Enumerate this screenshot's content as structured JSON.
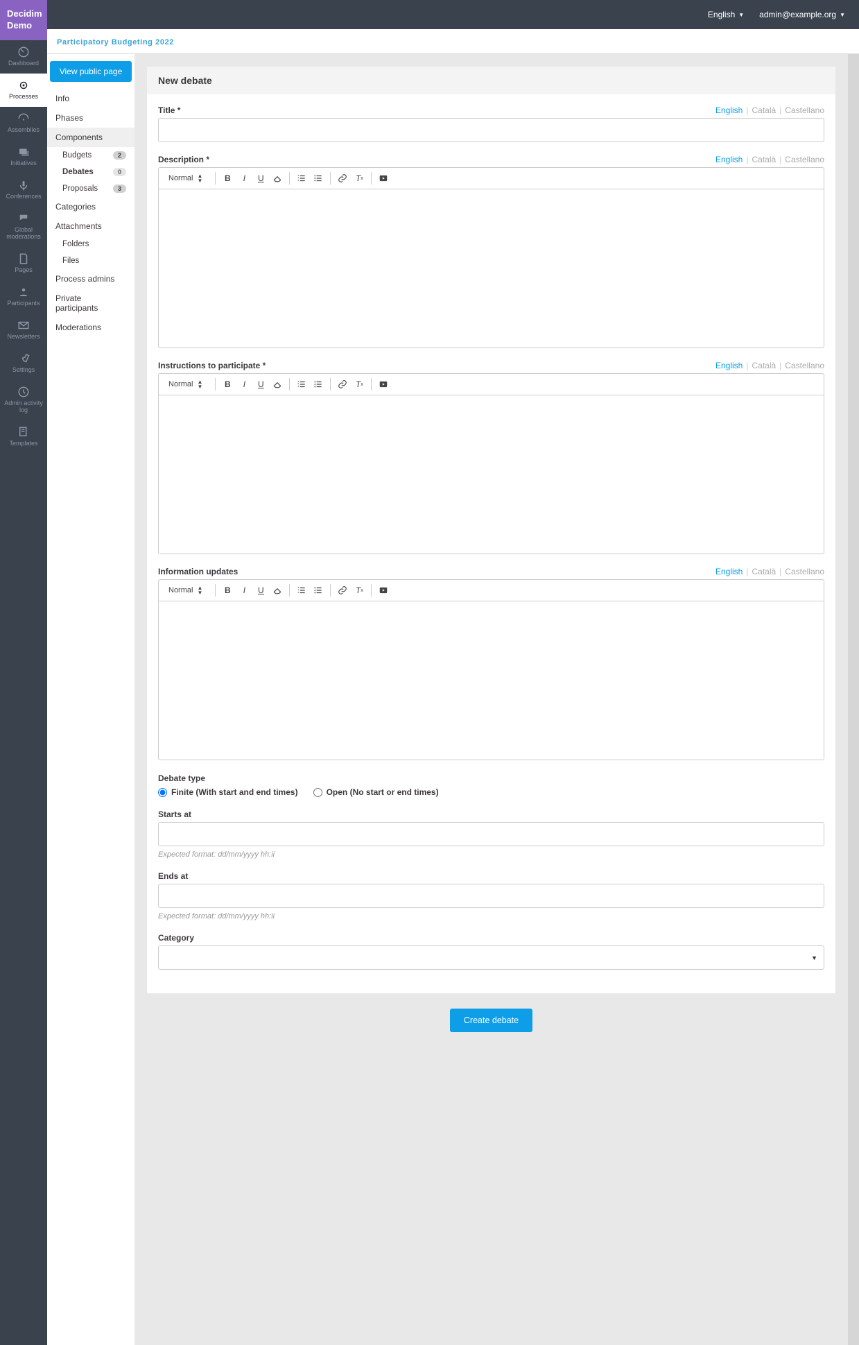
{
  "brand": "Decidim\nDemo",
  "topbar": {
    "language": "English",
    "user": "admin@example.org"
  },
  "primary_nav": [
    {
      "label": "Dashboard",
      "icon": "dashboard-icon"
    },
    {
      "label": "Processes",
      "icon": "processes-icon",
      "active": true
    },
    {
      "label": "Assemblies",
      "icon": "assemblies-icon"
    },
    {
      "label": "Initiatives",
      "icon": "initiatives-icon"
    },
    {
      "label": "Conferences",
      "icon": "conferences-icon"
    },
    {
      "label": "Global moderations",
      "icon": "moderations-icon"
    },
    {
      "label": "Pages",
      "icon": "pages-icon"
    },
    {
      "label": "Participants",
      "icon": "participants-icon"
    },
    {
      "label": "Newsletters",
      "icon": "newsletters-icon"
    },
    {
      "label": "Settings",
      "icon": "settings-icon"
    },
    {
      "label": "Admin activity log",
      "icon": "activity-log-icon"
    },
    {
      "label": "Templates",
      "icon": "templates-icon"
    }
  ],
  "breadcrumb": "Participatory Budgeting 2022",
  "btn_view_public": "View public page",
  "secondary_nav": {
    "items": [
      {
        "label": "Info"
      },
      {
        "label": "Phases"
      },
      {
        "label": "Components",
        "selected": true,
        "children": [
          {
            "label": "Budgets",
            "count": "2"
          },
          {
            "label": "Debates",
            "count": "0",
            "active": true
          },
          {
            "label": "Proposals",
            "count": "3"
          }
        ]
      },
      {
        "label": "Categories"
      },
      {
        "label": "Attachments",
        "children": [
          {
            "label": "Folders"
          },
          {
            "label": "Files"
          }
        ]
      },
      {
        "label": "Process admins"
      },
      {
        "label": "Private participants"
      },
      {
        "label": "Moderations"
      }
    ]
  },
  "page_title": "New debate",
  "languages": {
    "active": "English",
    "second": "Català",
    "third": "Castellano"
  },
  "fields": {
    "title": {
      "label": "Title *",
      "value": ""
    },
    "description": {
      "label": "Description *"
    },
    "instructions": {
      "label": "Instructions to participate *"
    },
    "updates": {
      "label": "Information updates"
    },
    "debate_type": {
      "label": "Debate type",
      "finite": "Finite (With start and end times)",
      "open": "Open (No start or end times)"
    },
    "starts_at": {
      "label": "Starts at",
      "value": "",
      "hint": "Expected format: dd/mm/yyyy hh:ii"
    },
    "ends_at": {
      "label": "Ends at",
      "value": "",
      "hint": "Expected format: dd/mm/yyyy hh:ii"
    },
    "category": {
      "label": "Category",
      "value": ""
    }
  },
  "editor_format_label": "Normal",
  "submit_label": "Create debate"
}
